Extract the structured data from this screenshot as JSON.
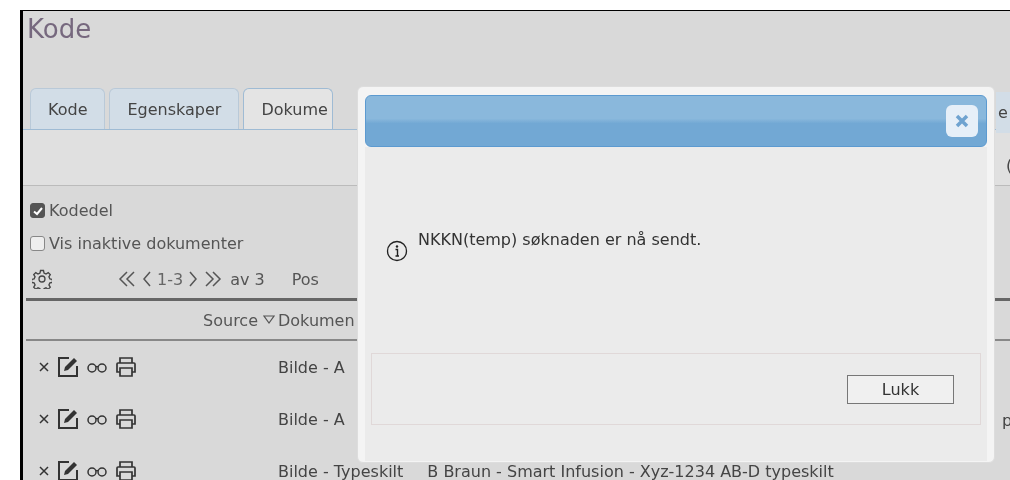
{
  "page": {
    "title": "Kode"
  },
  "tabs": [
    {
      "label": "Kode",
      "selected": false
    },
    {
      "label": "Egenskaper",
      "selected": false
    },
    {
      "label": "Dokume",
      "selected": true
    }
  ],
  "tab_fragment": "e",
  "toolbar_fragment": "(",
  "options": [
    {
      "label": "Kodedel",
      "checked": true
    },
    {
      "label": "Vis inaktive dokumenter",
      "checked": false
    }
  ],
  "pager": {
    "range": "1-3",
    "total": "av 3",
    "next_label": "Pos"
  },
  "table": {
    "columns": [
      {
        "label": "Source",
        "sorted": true
      },
      {
        "label": "Dokumen",
        "sorted": false
      }
    ],
    "rows": [
      {
        "cells": [
          "",
          "Bilde - A"
        ],
        "fragment": ""
      },
      {
        "cells": [
          "",
          "Bilde - A"
        ],
        "fragment": "p"
      },
      {
        "cells": [
          "",
          "Bilde - Typeskilt",
          "B Braun - Smart Infusion - Xyz-1234 AB-D  typeskilt"
        ],
        "fragment": ""
      }
    ]
  },
  "dialog": {
    "message": "NKKN(temp) søknaden er nå sendt.",
    "buttons": [
      "Lukk"
    ]
  }
}
